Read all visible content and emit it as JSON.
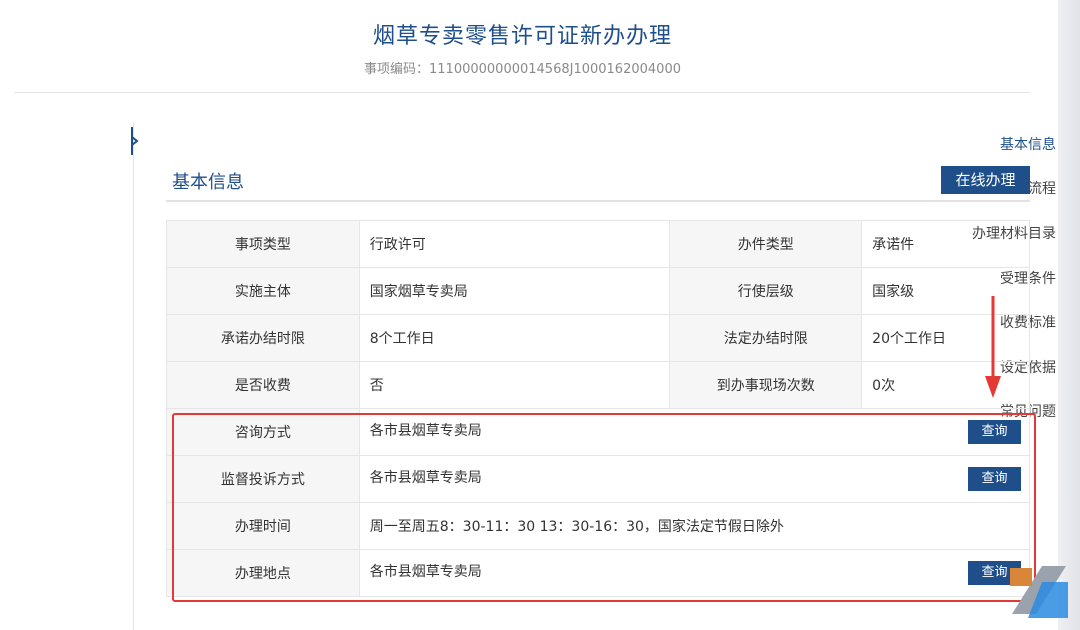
{
  "header": {
    "title": "烟草专卖零售许可证新办办理",
    "item_code": "事项编码：11100000000014568J1000162004000"
  },
  "sidebar": {
    "items": [
      {
        "label": "基本信息",
        "active": true
      },
      {
        "label": "办理流程"
      },
      {
        "label": "办理材料目录"
      },
      {
        "label": "受理条件"
      },
      {
        "label": "收费标准"
      },
      {
        "label": "设定依据"
      },
      {
        "label": "常见问题"
      }
    ]
  },
  "section": {
    "title": "基本信息",
    "online_button": "在线办理"
  },
  "table": {
    "rows4": [
      [
        "事项类型",
        "行政许可",
        "办件类型",
        "承诺件"
      ],
      [
        "实施主体",
        "国家烟草专卖局",
        "行使层级",
        "国家级"
      ],
      [
        "承诺办结时限",
        "8个工作日",
        "法定办结时限",
        "20个工作日"
      ],
      [
        "是否收费",
        "否",
        "到办事现场次数",
        "0次"
      ]
    ],
    "consult": {
      "label": "咨询方式",
      "value": "各市县烟草专卖局",
      "button": "查询"
    },
    "complaint": {
      "label": "监督投诉方式",
      "value": "各市县烟草专卖局",
      "button": "查询"
    },
    "hours": {
      "label": "办理时间",
      "value": "周一至周五8：30-11：30 13：30-16：30，国家法定节假日除外"
    },
    "location": {
      "label": "办理地点",
      "value": "各市县烟草专卖局",
      "button": "查询"
    }
  },
  "colors": {
    "brand_blue": "#1e4f8a",
    "annotation_red": "#e53935"
  },
  "icons": {
    "active_marker": "chevron-right-icon",
    "annotation_arrow": "arrow-down-icon",
    "watermark": "logo-icon"
  }
}
